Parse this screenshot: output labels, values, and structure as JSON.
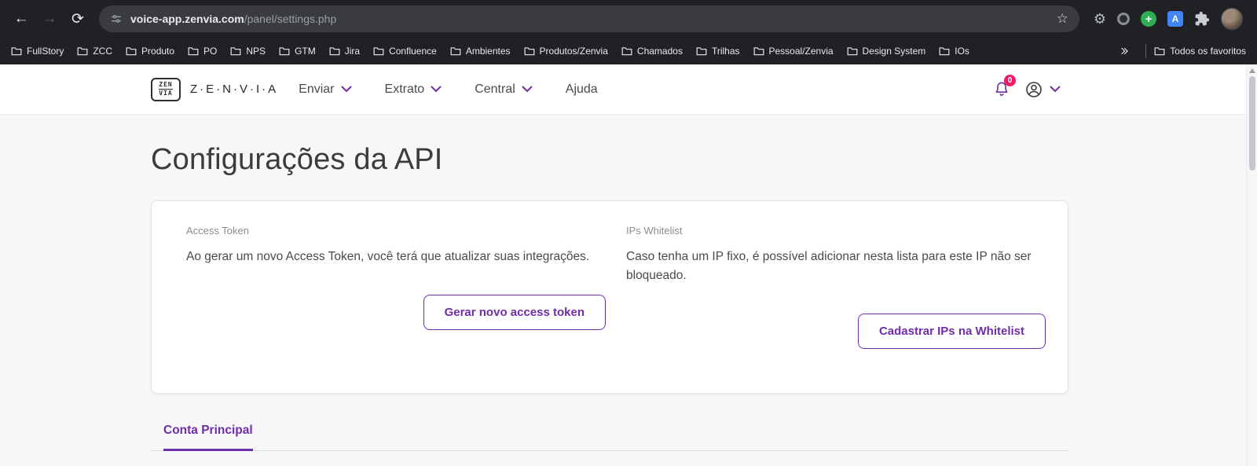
{
  "colors": {
    "accent": "#6f2da8",
    "badge": "#ec1c68",
    "chrome_dark": "#1f2125"
  },
  "icons": {
    "back": "←",
    "forward": "→",
    "refresh": "⟳",
    "star": "☆",
    "gear": "⚙",
    "plus": "+",
    "translate": "A"
  },
  "browser": {
    "url_host": "voice-app.zenvia.com",
    "url_path": "/panel/settings.php",
    "bookmarks": [
      "FullStory",
      "ZCC",
      "Produto",
      "PO",
      "NPS",
      "GTM",
      "Jira",
      "Confluence",
      "Ambientes",
      "Produtos/Zenvia",
      "Chamados",
      "Trilhas",
      "Pessoal/Zenvia",
      "Design System",
      "IOs"
    ],
    "all_bookmarks_label": "Todos os favoritos"
  },
  "logo": {
    "line1": "ZEN",
    "line2": "VIA"
  },
  "header": {
    "brand": "Z·E·N·V·I·A",
    "nav": [
      {
        "label": "Enviar"
      },
      {
        "label": "Extrato"
      },
      {
        "label": "Central"
      },
      {
        "label": "Ajuda"
      }
    ],
    "notification_count": "0"
  },
  "page": {
    "title": "Configurações da API",
    "card": {
      "access_token": {
        "label": "Access Token",
        "description": "Ao gerar um novo Access Token, você terá que atualizar suas integrações.",
        "button": "Gerar novo access token"
      },
      "whitelist": {
        "label": "IPs Whitelist",
        "description": "Caso tenha um IP fixo, é possível adicionar nesta lista para este IP não ser bloqueado.",
        "button": "Cadastrar IPs na Whitelist"
      }
    },
    "tab": "Conta Principal"
  }
}
